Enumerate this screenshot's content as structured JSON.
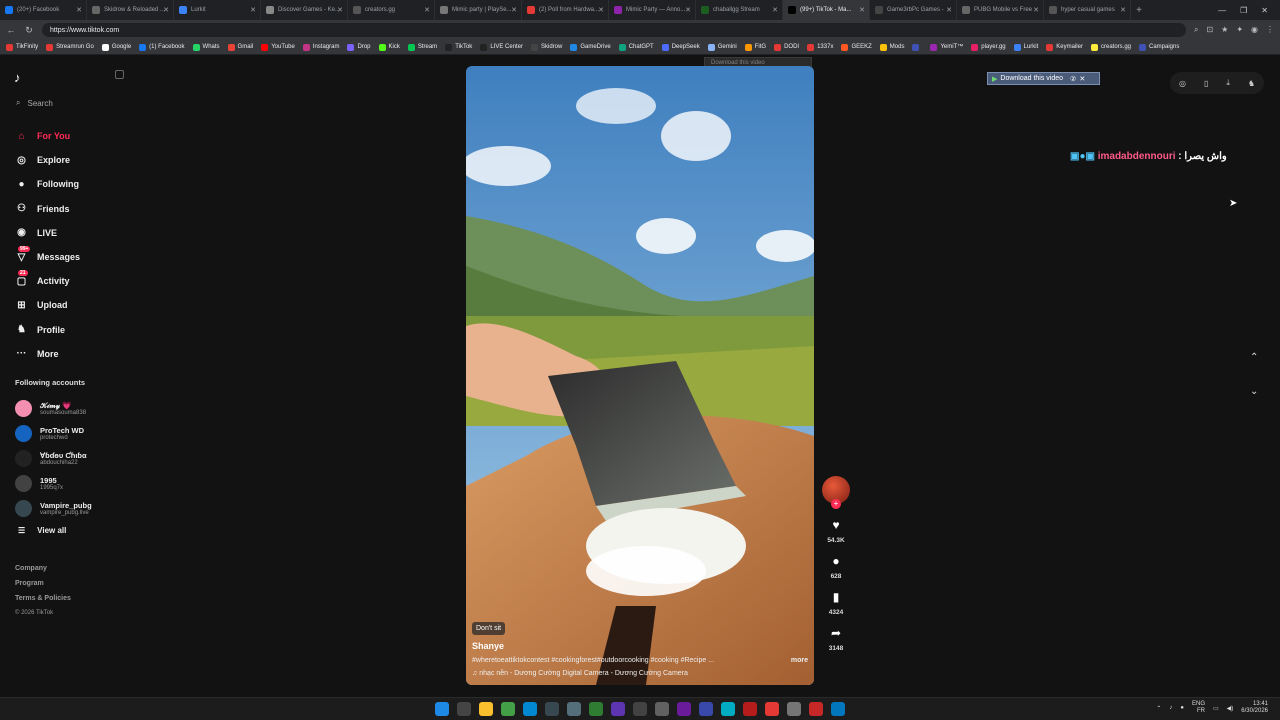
{
  "browser": {
    "tabs": [
      {
        "label": "(20+) Facebook",
        "color": "#1877f2",
        "active": false
      },
      {
        "label": "Skidrow & Reloaded ...",
        "color": "#666666",
        "active": false
      },
      {
        "label": "Lurkit",
        "color": "#3b82f6",
        "active": false
      },
      {
        "label": "Discover Games - Ke...",
        "color": "#888888",
        "active": false
      },
      {
        "label": "creators.gg",
        "color": "#555555",
        "active": false
      },
      {
        "label": "Mimic party | PlaySe...",
        "color": "#777777",
        "active": false
      },
      {
        "label": "(2) Poll from Hardwa...",
        "color": "#e53935",
        "active": false
      },
      {
        "label": "Mimic Party — Anno...",
        "color": "#8e24aa",
        "active": false
      },
      {
        "label": "chaballgg Stream",
        "color": "#1b5e20",
        "active": false
      },
      {
        "label": "(99+) TikTok - Ma...",
        "color": "#000000",
        "active": true
      },
      {
        "label": "Game3rbPc Games -",
        "color": "#444444",
        "active": false
      },
      {
        "label": "PUBG Mobile vs Free",
        "color": "#666666",
        "active": false
      },
      {
        "label": "hyper casual games",
        "color": "#555555",
        "active": false
      }
    ],
    "url": "https://www.tiktok.com",
    "bookmarks": [
      {
        "label": "TikFinity",
        "color": "#e53935"
      },
      {
        "label": "Streamrun Go",
        "color": "#e53935"
      },
      {
        "label": "Google",
        "color": "#ffffff"
      },
      {
        "label": "(1) Facebook",
        "color": "#1877f2"
      },
      {
        "label": "Whats",
        "color": "#25d366"
      },
      {
        "label": "Gmail",
        "color": "#ea4335"
      },
      {
        "label": "YouTube",
        "color": "#ff0000"
      },
      {
        "label": "Instagram",
        "color": "#c13584"
      },
      {
        "label": "Drop",
        "color": "#7b61ff"
      },
      {
        "label": "Kick",
        "color": "#53fc18"
      },
      {
        "label": "Stream",
        "color": "#00c853"
      },
      {
        "label": "TikTok",
        "color": "#222222"
      },
      {
        "label": "LIVE Center",
        "color": "#222222"
      },
      {
        "label": "Skidrow",
        "color": "#444444"
      },
      {
        "label": "GameDrive",
        "color": "#1e88e5"
      },
      {
        "label": "ChatGPT",
        "color": "#10a37f"
      },
      {
        "label": "DeepSeek",
        "color": "#4d6bfe"
      },
      {
        "label": "Gemini",
        "color": "#8ab4f8"
      },
      {
        "label": "FitG",
        "color": "#ff9800"
      },
      {
        "label": "DODI",
        "color": "#e53935"
      },
      {
        "label": "1337x",
        "color": "#e53935"
      },
      {
        "label": "GEEKZ",
        "color": "#ff5722"
      },
      {
        "label": "Mods",
        "color": "#ffc107"
      },
      {
        "label": "",
        "color": "#3f51b5"
      },
      {
        "label": "YemiT™",
        "color": "#9c27b0"
      },
      {
        "label": "player.gg",
        "color": "#e91e63"
      },
      {
        "label": "Lurkit",
        "color": "#3b82f6"
      },
      {
        "label": "Keymailer",
        "color": "#e53935"
      },
      {
        "label": "creators.gg",
        "color": "#ffeb3b"
      },
      {
        "label": "Campaigns",
        "color": "#3f51b5"
      }
    ]
  },
  "sidebar": {
    "search_placeholder": "Search",
    "nav": [
      {
        "label": "For You",
        "icon": "home-icon",
        "glyph": "⌂",
        "active": true,
        "badge": ""
      },
      {
        "label": "Explore",
        "icon": "compass-icon",
        "glyph": "◎",
        "active": false,
        "badge": ""
      },
      {
        "label": "Following",
        "icon": "avatar-icon",
        "glyph": "●",
        "active": false,
        "badge": ""
      },
      {
        "label": "Friends",
        "icon": "friends-icon",
        "glyph": "⚇",
        "active": false,
        "badge": ""
      },
      {
        "label": "LIVE",
        "icon": "live-icon",
        "glyph": "◉",
        "active": false,
        "badge": ""
      },
      {
        "label": "Messages",
        "icon": "messages-icon",
        "glyph": "▽",
        "active": false,
        "badge": "99+"
      },
      {
        "label": "Activity",
        "icon": "activity-icon",
        "glyph": "▢",
        "active": false,
        "badge": "21"
      },
      {
        "label": "Upload",
        "icon": "upload-icon",
        "glyph": "⊞",
        "active": false,
        "badge": ""
      },
      {
        "label": "Profile",
        "icon": "profile-icon",
        "glyph": "♞",
        "active": false,
        "badge": ""
      },
      {
        "label": "More",
        "icon": "more-icon",
        "glyph": "···",
        "active": false,
        "badge": ""
      }
    ],
    "following_title": "Following accounts",
    "accounts": [
      {
        "name": "𝒦𝒾𝓂𝓎 💗",
        "handle": "soumasouma838",
        "color": "#f48fb1"
      },
      {
        "name": "ProTech WD",
        "handle": "protechwd",
        "color": "#1565c0"
      },
      {
        "name": "Ɐɓɗɵυ Ƈɦιɓα",
        "handle": "abdouchiha22",
        "color": "#222222"
      },
      {
        "name": "1995",
        "handle": "1995q7x",
        "color": "#424242"
      },
      {
        "name": "Vampire_pubg",
        "handle": "vampire_pubg.live",
        "color": "#37474f"
      }
    ],
    "view_all": "View all",
    "footer": [
      "Company",
      "Program",
      "Terms & Policies"
    ],
    "copyright": "© 2026 TikTok"
  },
  "video": {
    "download_hint": "Download this video",
    "tag": "Don't sit",
    "author": "Shanye",
    "description": "#wheretoeattiktokcontest #cookingforest#outdoorcooking #cooking #Recipe ...",
    "more": "more",
    "music": "nhạc nền - Dương Cường Digital Camera - Dương Cường Camera"
  },
  "actions": {
    "likes": "54.3K",
    "comments": "628",
    "saves": "4324",
    "shares": "3148"
  },
  "overlay": {
    "download_ext": "Download this video",
    "chat_user": "imadabdennouri",
    "chat_text": ": واش يصرا"
  },
  "taskbar": {
    "lang": "ENG",
    "region": "FR",
    "time": "13:41",
    "date": "6/30/2026"
  }
}
